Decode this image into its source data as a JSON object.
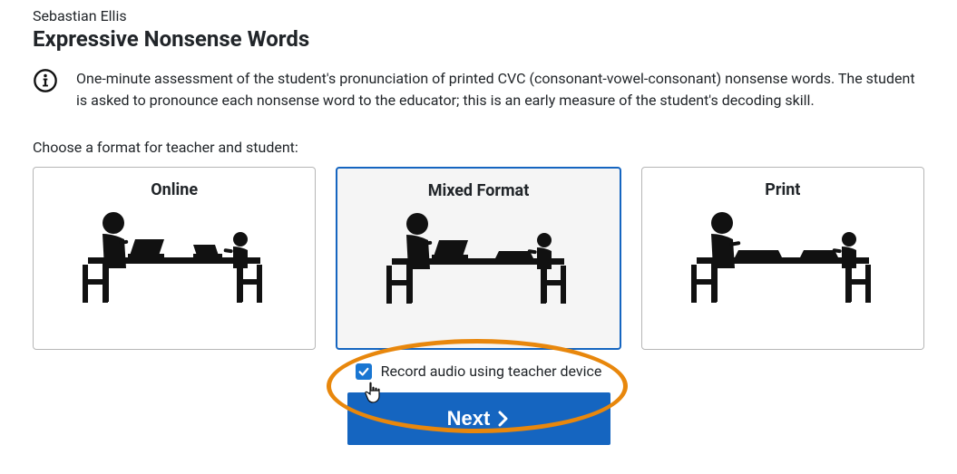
{
  "student_name": "Sebastian Ellis",
  "page_title": "Expressive Nonsense Words",
  "info_text": "One-minute assessment of the student's pronunciation of printed CVC (consonant-vowel-consonant) nonsense words. The student is asked to pronounce each nonsense word to the educator; this is an early measure of the student's decoding skill.",
  "choose_label": "Choose a format for teacher and student:",
  "formats": {
    "online": {
      "title": "Online",
      "selected": false
    },
    "mixed": {
      "title": "Mixed Format",
      "selected": true
    },
    "print": {
      "title": "Print",
      "selected": false
    }
  },
  "record": {
    "label": "Record audio using teacher device",
    "checked": true
  },
  "next_button": "Next"
}
